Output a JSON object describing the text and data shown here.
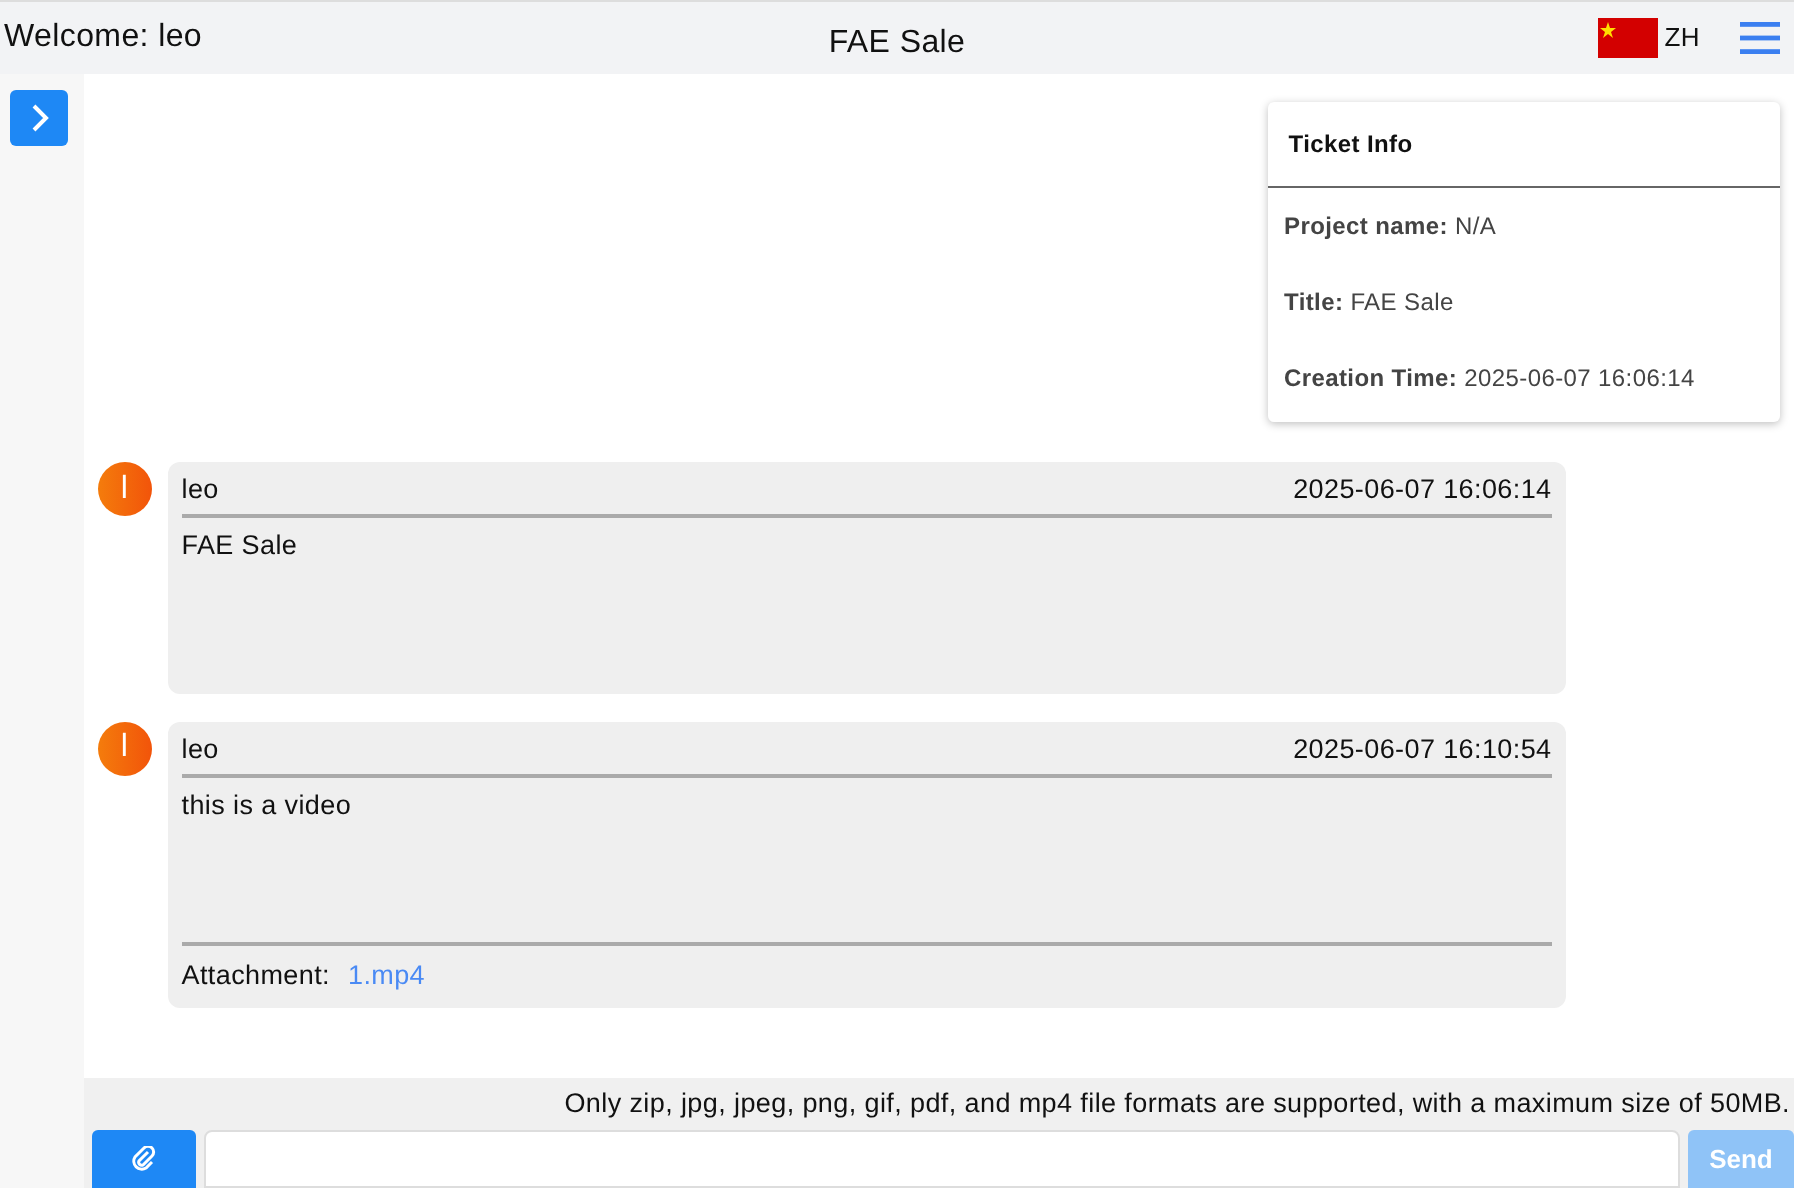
{
  "header": {
    "welcome": "Welcome: leo",
    "title": "FAE Sale",
    "language": "ZH"
  },
  "ticket_info": {
    "heading": "Ticket Info",
    "fields": [
      {
        "label": "Project name:",
        "value": "N/A"
      },
      {
        "label": "Title:",
        "value": "FAE Sale"
      },
      {
        "label": "Creation Time:",
        "value": "2025-06-07 16:06:14"
      }
    ]
  },
  "messages": [
    {
      "avatar": "l",
      "author": "leo",
      "time": "2025-06-07 16:06:14",
      "text": "FAE Sale"
    },
    {
      "avatar": "l",
      "author": "leo",
      "time": "2025-06-07 16:10:54",
      "text": "this is a video",
      "attachment": {
        "label": "Attachment:",
        "file": "1.mp4"
      }
    }
  ],
  "upload_note": "Only zip, jpg, jpeg, png, gif, pdf, and mp4 file formats are supported, with a maximum size of 50MB.",
  "send_button": {
    "label": "Send",
    "disabled": true
  }
}
